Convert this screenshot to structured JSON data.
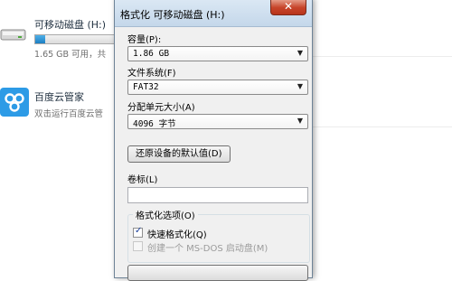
{
  "explorer": {
    "drive": {
      "name": "可移动磁盘 (H:)",
      "free_text": "1.65 GB 可用，共",
      "used_fraction": 0.12
    },
    "app": {
      "name": "百度云管家",
      "description": "双击运行百度云管"
    }
  },
  "dialog": {
    "title": "格式化 可移动磁盘 (H:)",
    "close_glyph": "✕",
    "capacity": {
      "label": "容量(P):",
      "value": "1.86 GB"
    },
    "filesystem": {
      "label": "文件系统(F)",
      "value": "FAT32"
    },
    "allocation": {
      "label": "分配单元大小(A)",
      "value": "4096 字节"
    },
    "restore_defaults_label": "还原设备的默认值(D)",
    "volume_label": {
      "label": "卷标(L)",
      "value": ""
    },
    "options": {
      "title": "格式化选项(O)",
      "quick_format": {
        "label": "快速格式化(Q)",
        "checked": true
      },
      "msdos_boot": {
        "label": "创建一个 MS-DOS 启动盘(M)",
        "checked": false
      }
    }
  },
  "colors": {
    "titlebar": "#c4d7ea",
    "close_button": "#c7452a",
    "progress_fill": "#1c7fc3",
    "dialog_bg": "#f0f0f0"
  }
}
